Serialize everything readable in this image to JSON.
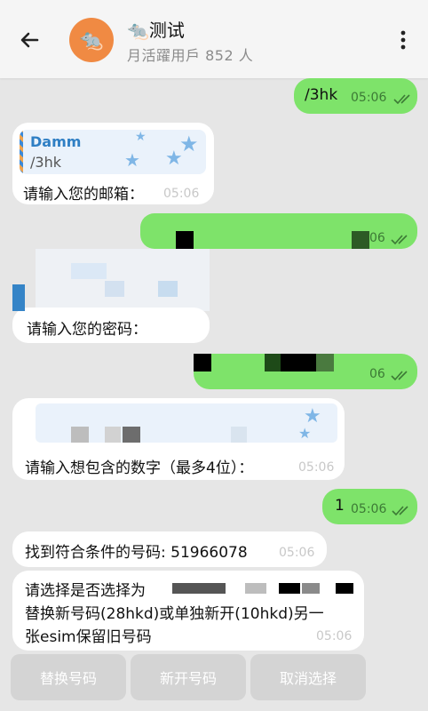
{
  "header": {
    "title": "🐀测试",
    "subtitle": "月活躍用戶 852 人"
  },
  "messages": {
    "m1": {
      "text": "/3hk",
      "time": "05:06"
    },
    "m2": {
      "reply_name": "Damm",
      "reply_text": "/3hk",
      "text": "请输入您的邮箱：",
      "time": "05:06"
    },
    "m3": {
      "time": "06"
    },
    "m4": {
      "text": "请输入您的密码："
    },
    "m5": {
      "time": "06"
    },
    "m6": {
      "text": "请输入想包含的数字（最多4位）：",
      "time": "05:06"
    },
    "m7": {
      "text": "1",
      "time": "05:06"
    },
    "m8": {
      "text": "找到符合条件的号码: 51966078",
      "time": "05:06"
    },
    "m9": {
      "line1": "请选择是否选择为",
      "line2": "替换新号码(28hkd)或单独新开(10hkd)另一",
      "line3": "张esim保留旧号码",
      "time": "05:06"
    }
  },
  "buttons": {
    "replace": "替换号码",
    "new": "新开号码",
    "cancel": "取消选择"
  },
  "colors": {
    "outgoing_bubble": "#7ee36a",
    "incoming_bubble": "#ffffff",
    "avatar": "#f08a43",
    "background": "#e6e6e6",
    "button": "#d4d4d4"
  }
}
